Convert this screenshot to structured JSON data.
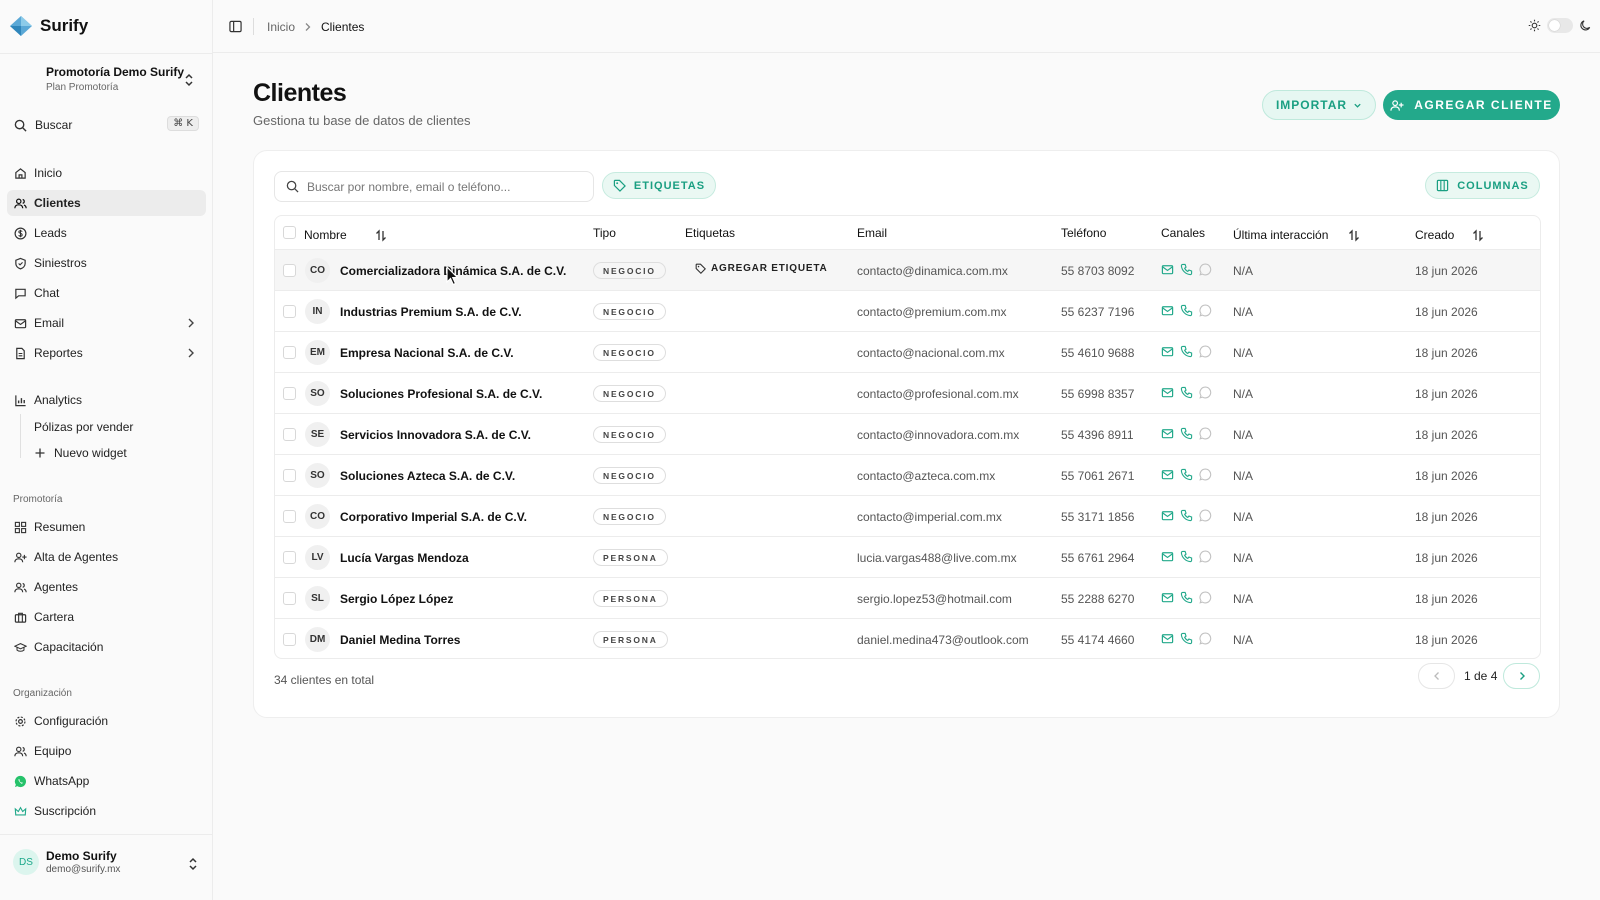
{
  "app": {
    "name": "Surify"
  },
  "colors": {
    "accent": "#23a98b",
    "accent_soft": "#e6f7f2"
  },
  "sidebar": {
    "org_name": "Promotoría Demo Surify",
    "org_plan": "Plan Promotoría",
    "search_label": "Buscar",
    "search_shortcut": "⌘ K",
    "items": [
      {
        "label": "Inicio",
        "icon": "home-icon"
      },
      {
        "label": "Clientes",
        "icon": "users-icon"
      },
      {
        "label": "Leads",
        "icon": "dollar-icon"
      },
      {
        "label": "Siniestros",
        "icon": "shield-icon"
      },
      {
        "label": "Chat",
        "icon": "chat-icon"
      },
      {
        "label": "Email",
        "icon": "mail-icon"
      },
      {
        "label": "Reportes",
        "icon": "file-icon"
      },
      {
        "label": "Analytics",
        "icon": "chart-icon"
      }
    ],
    "analytics_sub": [
      "Pólizas por vender",
      "Nuevo widget"
    ],
    "section_promotoria": "Promotoría",
    "promotoria_items": [
      {
        "label": "Resumen",
        "icon": "grid-icon"
      },
      {
        "label": "Alta de Agentes",
        "icon": "user-plus-icon"
      },
      {
        "label": "Agentes",
        "icon": "users-icon"
      },
      {
        "label": "Cartera",
        "icon": "briefcase-icon"
      },
      {
        "label": "Capacitación",
        "icon": "graduation-icon"
      }
    ],
    "section_org": "Organización",
    "org_items": [
      {
        "label": "Configuración",
        "icon": "gear-icon"
      },
      {
        "label": "Equipo",
        "icon": "users-icon"
      },
      {
        "label": "WhatsApp",
        "icon": "whatsapp-icon"
      },
      {
        "label": "Suscripción",
        "icon": "crown-icon"
      }
    ],
    "user": {
      "initials": "DS",
      "name": "Demo Surify",
      "email": "demo@surify.mx"
    }
  },
  "topbar": {
    "breadcrumb_home": "Inicio",
    "breadcrumb_current": "Clientes"
  },
  "main": {
    "title": "Clientes",
    "subtitle": "Gestiona tu base de datos de clientes",
    "import_label": "IMPORTAR",
    "add_label": "AGREGAR CLIENTE"
  },
  "table": {
    "search_placeholder": "Buscar por nombre, email o teléfono...",
    "tags_label": "ETIQUETAS",
    "columns_label": "COLUMNAS",
    "headers": {
      "name": "Nombre",
      "type": "Tipo",
      "tags": "Etiquetas",
      "email": "Email",
      "phone": "Teléfono",
      "channels": "Canales",
      "last": "Última interacción",
      "created": "Creado"
    },
    "add_tag_label": "AGREGAR ETIQUETA",
    "rows": [
      {
        "initials": "CO",
        "name": "Comercializadora Dinámica S.A. de C.V.",
        "type": "NEGOCIO",
        "email": "contacto@dinamica.com.mx",
        "phone": "55 8703 8092",
        "last": "N/A",
        "created": "18 jun 2026"
      },
      {
        "initials": "IN",
        "name": "Industrias Premium S.A. de C.V.",
        "type": "NEGOCIO",
        "email": "contacto@premium.com.mx",
        "phone": "55 6237 7196",
        "last": "N/A",
        "created": "18 jun 2026"
      },
      {
        "initials": "EM",
        "name": "Empresa Nacional S.A. de C.V.",
        "type": "NEGOCIO",
        "email": "contacto@nacional.com.mx",
        "phone": "55 4610 9688",
        "last": "N/A",
        "created": "18 jun 2026"
      },
      {
        "initials": "SO",
        "name": "Soluciones Profesional S.A. de C.V.",
        "type": "NEGOCIO",
        "email": "contacto@profesional.com.mx",
        "phone": "55 6998 8357",
        "last": "N/A",
        "created": "18 jun 2026"
      },
      {
        "initials": "SE",
        "name": "Servicios Innovadora S.A. de C.V.",
        "type": "NEGOCIO",
        "email": "contacto@innovadora.com.mx",
        "phone": "55 4396 8911",
        "last": "N/A",
        "created": "18 jun 2026"
      },
      {
        "initials": "SO",
        "name": "Soluciones Azteca S.A. de C.V.",
        "type": "NEGOCIO",
        "email": "contacto@azteca.com.mx",
        "phone": "55 7061 2671",
        "last": "N/A",
        "created": "18 jun 2026"
      },
      {
        "initials": "CO",
        "name": "Corporativo Imperial S.A. de C.V.",
        "type": "NEGOCIO",
        "email": "contacto@imperial.com.mx",
        "phone": "55 3171 1856",
        "last": "N/A",
        "created": "18 jun 2026"
      },
      {
        "initials": "LV",
        "name": "Lucía Vargas Mendoza",
        "type": "PERSONA",
        "email": "lucia.vargas488@live.com.mx",
        "phone": "55 6761 2964",
        "last": "N/A",
        "created": "18 jun 2026"
      },
      {
        "initials": "SL",
        "name": "Sergio López López",
        "type": "PERSONA",
        "email": "sergio.lopez53@hotmail.com",
        "phone": "55 2288 6270",
        "last": "N/A",
        "created": "18 jun 2026"
      },
      {
        "initials": "DM",
        "name": "Daniel Medina Torres",
        "type": "PERSONA",
        "email": "daniel.medina473@outlook.com",
        "phone": "55 4174 4660",
        "last": "N/A",
        "created": "18 jun 2026"
      }
    ],
    "total_label": "34 clientes en total",
    "page_label": "1 de 4"
  }
}
